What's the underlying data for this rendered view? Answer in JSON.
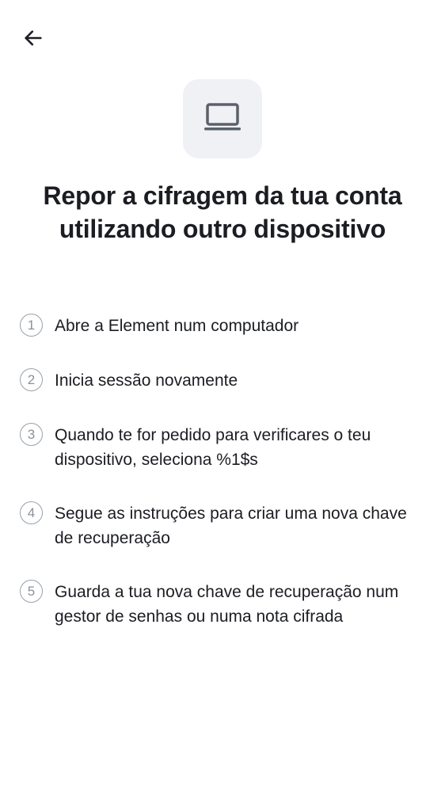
{
  "header": {
    "back_icon": "arrow-left-icon"
  },
  "hero": {
    "icon": "laptop-icon"
  },
  "title": "Repor a cifragem da tua conta utilizando outro dispositivo",
  "steps": [
    {
      "number": "1",
      "text": "Abre a Element num computador"
    },
    {
      "number": "2",
      "text": "Inicia sessão novamente"
    },
    {
      "number": "3",
      "text": "Quando te for pedido para verificares o teu dispositivo, seleciona %1$s"
    },
    {
      "number": "4",
      "text": "Segue as instruções para criar uma nova chave de recuperação"
    },
    {
      "number": "5",
      "text": "Guarda a tua nova chave de recuperação num gestor de senhas ou numa nota cifrada"
    }
  ],
  "colors": {
    "background": "#ffffff",
    "text": "#1b1d22",
    "icon_bg": "#eff1f5",
    "step_border": "#9aa1ab"
  }
}
